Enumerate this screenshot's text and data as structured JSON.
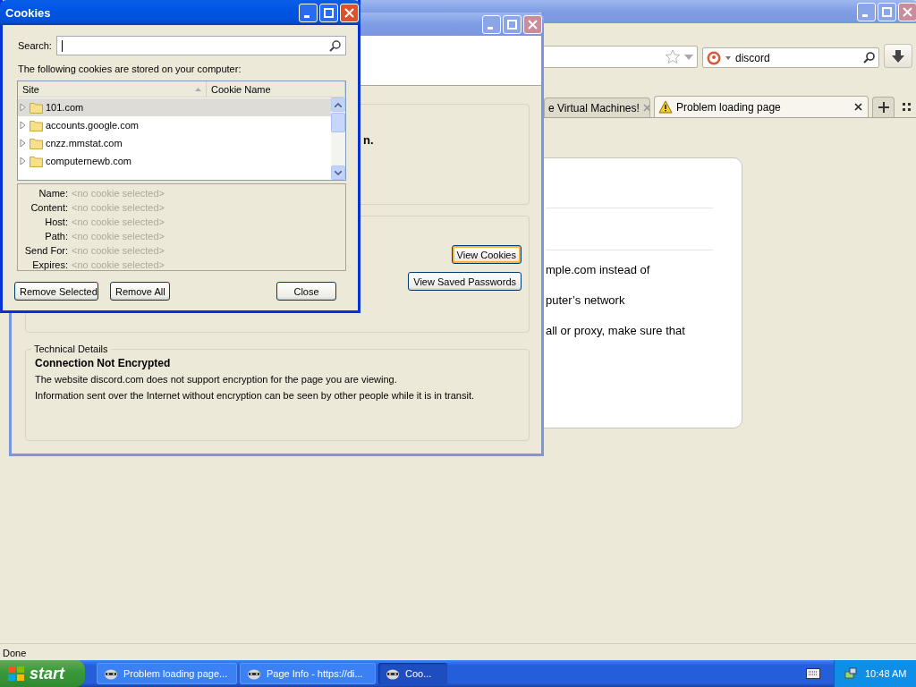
{
  "browser": {
    "search_field": {
      "value": "discord"
    },
    "tabs": [
      {
        "label": "e Virtual Machines!",
        "selected": false,
        "warning": false
      },
      {
        "label": "Problem loading page",
        "selected": true,
        "warning": true
      }
    ],
    "error_card": {
      "lines": [
        "mple.com instead of",
        "puter’s network",
        "all or proxy, make sure that"
      ]
    },
    "status_bar": "Done"
  },
  "page_info": {
    "heading_fragment": "n.",
    "buttons": [
      {
        "label": "View Cookies",
        "focused": true
      },
      {
        "label": "View Saved Passwords",
        "focused": false
      }
    ],
    "technical_details": {
      "legend": "Technical Details",
      "title": "Connection Not Encrypted",
      "lines": [
        "The website discord.com does not support encryption for the page you are viewing.",
        "Information sent over the Internet without encryption can be seen by other people while it is in transit."
      ]
    }
  },
  "cookies_dialog": {
    "title": "Cookies",
    "search": {
      "label": "Search:"
    },
    "intro": "The following cookies are stored on your computer:",
    "columns": [
      "Site",
      "Cookie Name"
    ],
    "sites": [
      {
        "name": "101.com",
        "selected": true
      },
      {
        "name": "accounts.google.com",
        "selected": false
      },
      {
        "name": "cnzz.mmstat.com",
        "selected": false
      },
      {
        "name": "computernewb.com",
        "selected": false
      }
    ],
    "details": [
      {
        "label": "Name:",
        "value": "<no cookie selected>"
      },
      {
        "label": "Content:",
        "value": "<no cookie selected>"
      },
      {
        "label": "Host:",
        "value": "<no cookie selected>"
      },
      {
        "label": "Path:",
        "value": "<no cookie selected>"
      },
      {
        "label": "Send For:",
        "value": "<no cookie selected>"
      },
      {
        "label": "Expires:",
        "value": "<no cookie selected>"
      }
    ],
    "buttons": [
      "Remove Selected",
      "Remove All",
      "Close"
    ]
  },
  "taskbar": {
    "start": "start",
    "tasks": [
      {
        "label": "Problem loading page...",
        "selected": false
      },
      {
        "label": "Page Info - https://di...",
        "selected": false
      },
      {
        "label": "Coo...",
        "selected": true
      }
    ],
    "clock": "10:48 AM"
  }
}
